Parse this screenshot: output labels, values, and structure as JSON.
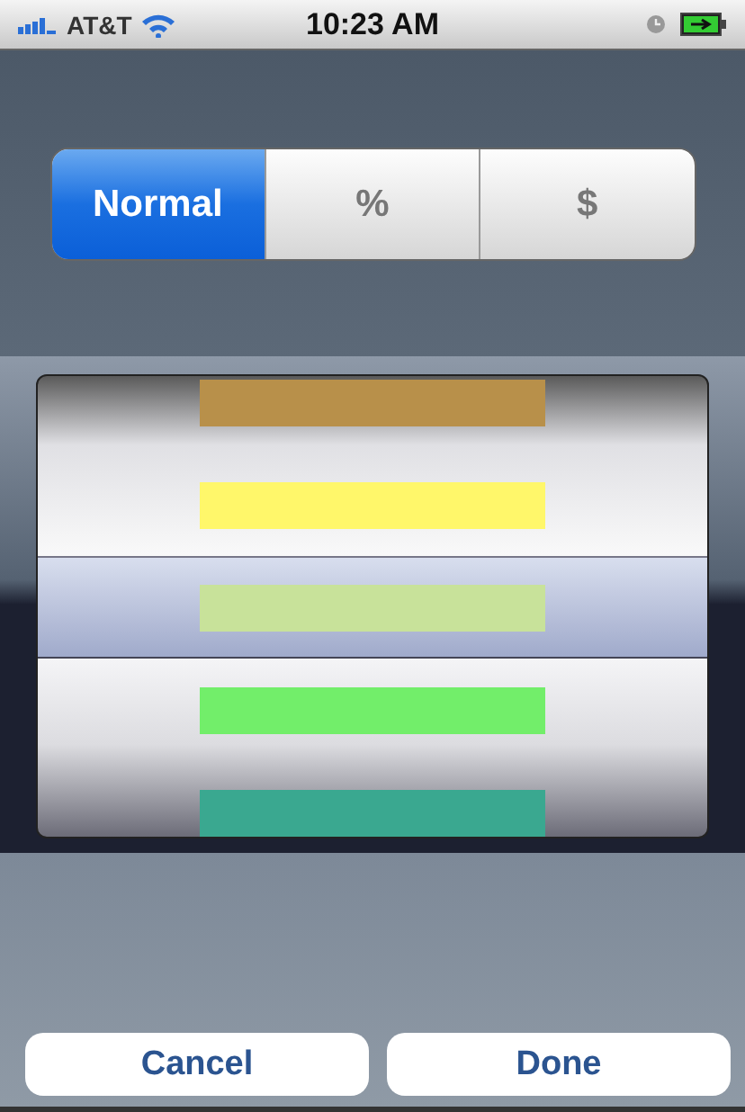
{
  "status_bar": {
    "carrier": "AT&T",
    "time": "10:23 AM"
  },
  "segments": [
    {
      "label": "Normal",
      "selected": true
    },
    {
      "label": "%",
      "selected": false
    },
    {
      "label": "$",
      "selected": false
    }
  ],
  "picker": {
    "items": [
      {
        "color": "#b8904a",
        "selected": false
      },
      {
        "color": "#fff76a",
        "selected": false
      },
      {
        "color": "#c8e29a",
        "selected": true
      },
      {
        "color": "#72ee6a",
        "selected": false
      },
      {
        "color": "#3aa890",
        "selected": false
      }
    ]
  },
  "buttons": [
    {
      "label": "Cancel"
    },
    {
      "label": "Done"
    }
  ]
}
